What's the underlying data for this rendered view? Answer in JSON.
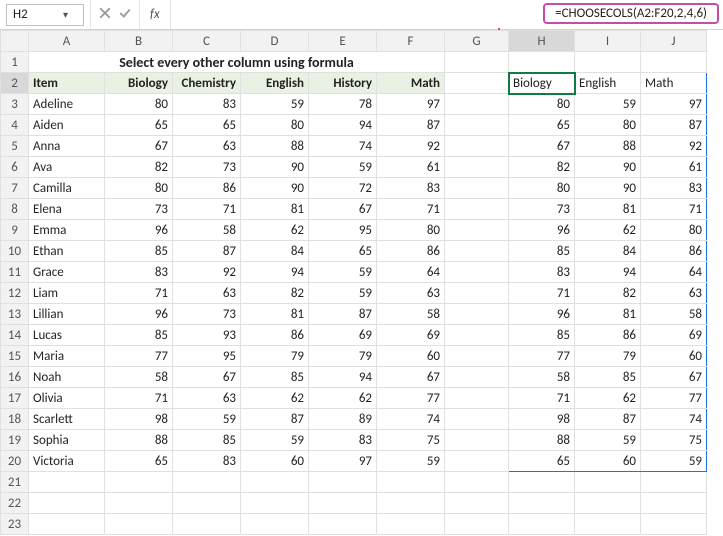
{
  "namebox": {
    "value": "H2"
  },
  "formula": {
    "text": "=CHOOSECOLS(A2:F20,2,4,6)"
  },
  "title": "Select every other column using formula",
  "columns": [
    "",
    "A",
    "B",
    "C",
    "D",
    "E",
    "F",
    "G",
    "H",
    "I",
    "J"
  ],
  "headers": {
    "A": "Item",
    "B": "Biology",
    "C": "Chemistry",
    "D": "English",
    "E": "History",
    "F": "Math"
  },
  "spillHeaders": {
    "H": "Biology",
    "I": "English",
    "J": "Math"
  },
  "rows": [
    {
      "n": "3",
      "a": "Adeline",
      "b": 80,
      "c": 83,
      "d": 59,
      "e": 78,
      "f": 97
    },
    {
      "n": "4",
      "a": "Aiden",
      "b": 65,
      "c": 65,
      "d": 80,
      "e": 94,
      "f": 87
    },
    {
      "n": "5",
      "a": "Anna",
      "b": 67,
      "c": 63,
      "d": 88,
      "e": 74,
      "f": 92
    },
    {
      "n": "6",
      "a": "Ava",
      "b": 82,
      "c": 73,
      "d": 90,
      "e": 59,
      "f": 61
    },
    {
      "n": "7",
      "a": "Camilla",
      "b": 80,
      "c": 86,
      "d": 90,
      "e": 72,
      "f": 83
    },
    {
      "n": "8",
      "a": "Elena",
      "b": 73,
      "c": 71,
      "d": 81,
      "e": 67,
      "f": 71
    },
    {
      "n": "9",
      "a": "Emma",
      "b": 96,
      "c": 58,
      "d": 62,
      "e": 95,
      "f": 80
    },
    {
      "n": "10",
      "a": "Ethan",
      "b": 85,
      "c": 87,
      "d": 84,
      "e": 65,
      "f": 86
    },
    {
      "n": "11",
      "a": "Grace",
      "b": 83,
      "c": 92,
      "d": 94,
      "e": 59,
      "f": 64
    },
    {
      "n": "12",
      "a": "Liam",
      "b": 71,
      "c": 63,
      "d": 82,
      "e": 59,
      "f": 63
    },
    {
      "n": "13",
      "a": "Lillian",
      "b": 96,
      "c": 73,
      "d": 81,
      "e": 87,
      "f": 58
    },
    {
      "n": "14",
      "a": "Lucas",
      "b": 85,
      "c": 93,
      "d": 86,
      "e": 69,
      "f": 69
    },
    {
      "n": "15",
      "a": "Maria",
      "b": 77,
      "c": 95,
      "d": 79,
      "e": 79,
      "f": 60
    },
    {
      "n": "16",
      "a": "Noah",
      "b": 58,
      "c": 67,
      "d": 85,
      "e": 94,
      "f": 67
    },
    {
      "n": "17",
      "a": "Olivia",
      "b": 71,
      "c": 63,
      "d": 62,
      "e": 62,
      "f": 77
    },
    {
      "n": "18",
      "a": "Scarlett",
      "b": 98,
      "c": 59,
      "d": 87,
      "e": 89,
      "f": 74
    },
    {
      "n": "19",
      "a": "Sophia",
      "b": 88,
      "c": 85,
      "d": 59,
      "e": 83,
      "f": 75
    },
    {
      "n": "20",
      "a": "Victoria",
      "b": 65,
      "c": 83,
      "d": 60,
      "e": 97,
      "f": 59
    }
  ],
  "emptyRows": [
    "21",
    "22",
    "23"
  ]
}
